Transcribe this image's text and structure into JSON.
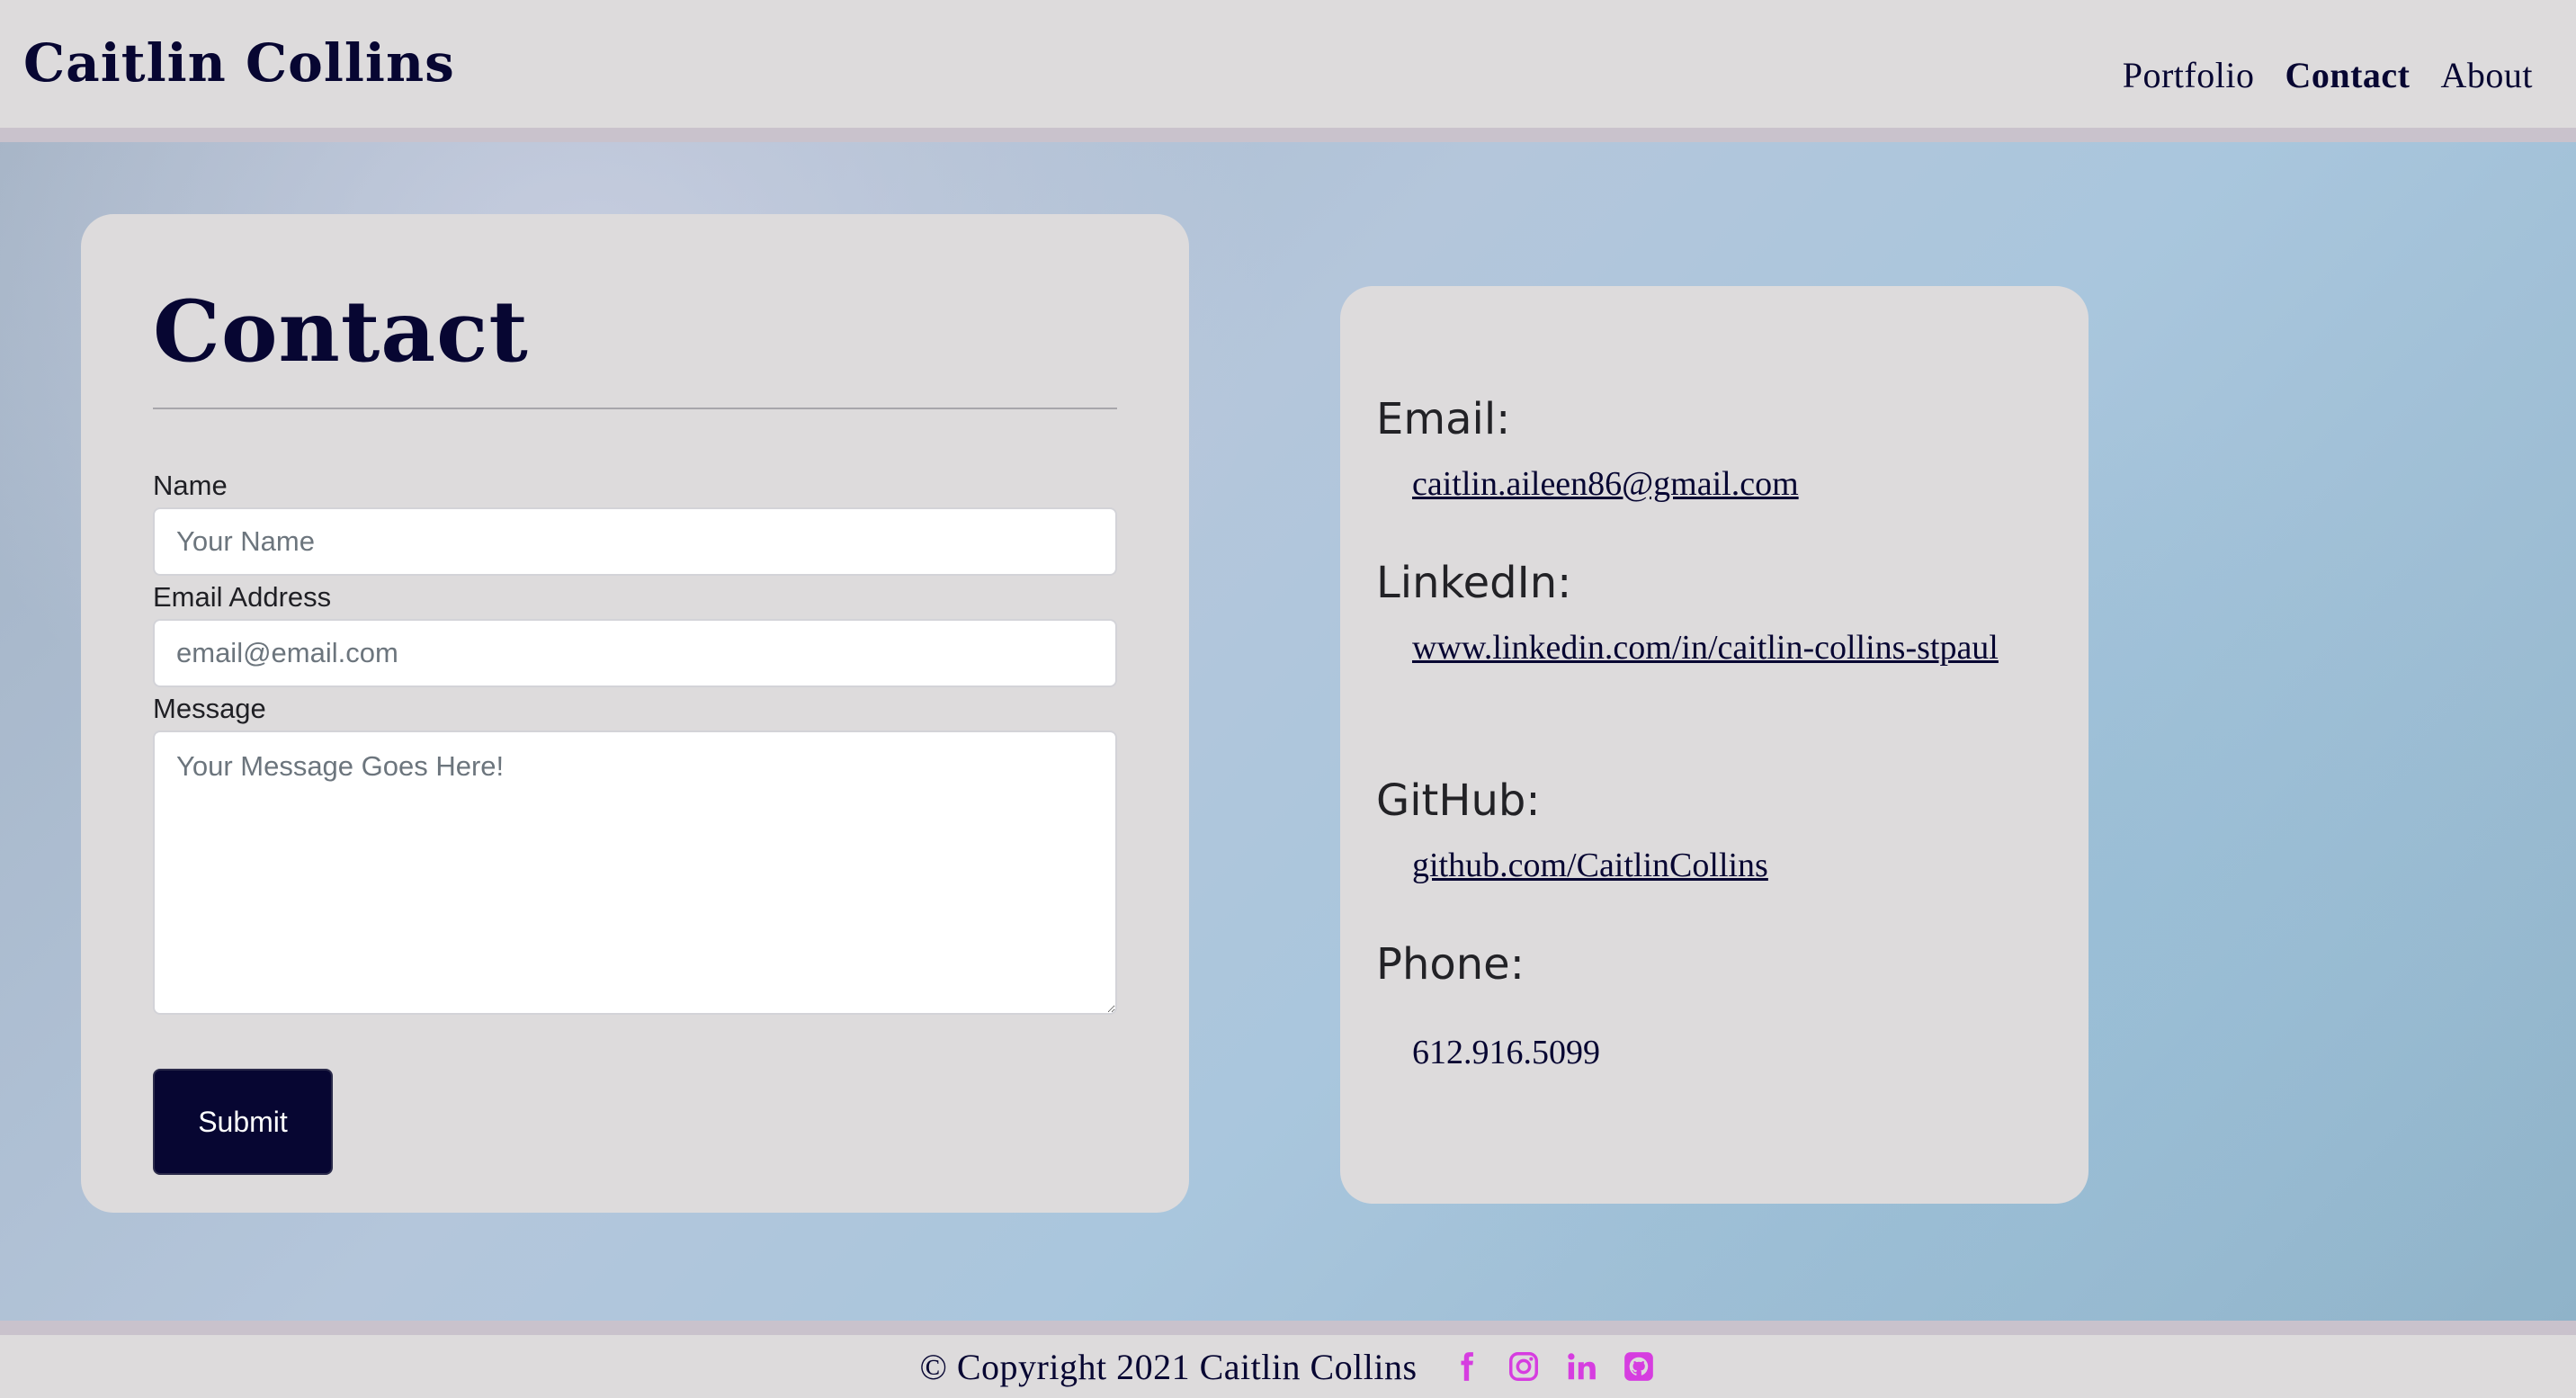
{
  "header": {
    "brand": "Caitlin Collins",
    "nav": [
      {
        "label": "Portfolio",
        "active": false
      },
      {
        "label": "Contact",
        "active": true
      },
      {
        "label": "About",
        "active": false
      }
    ]
  },
  "form": {
    "title": "Contact",
    "name_label": "Name",
    "name_placeholder": "Your Name",
    "email_label": "Email Address",
    "email_placeholder": "email@email.com",
    "message_label": "Message",
    "message_placeholder": "Your Message Goes Here!",
    "submit_label": "Submit"
  },
  "info": {
    "email_heading": "Email:",
    "email_value": "caitlin.aileen86@gmail.com",
    "linkedin_heading": "LinkedIn:",
    "linkedin_value": "www.linkedin.com/in/caitlin-collins-stpaul",
    "github_heading": "GitHub:",
    "github_value": "github.com/CaitlinCollins",
    "phone_heading": "Phone:",
    "phone_value": "612.916.5099"
  },
  "footer": {
    "copyright": "© Copyright 2021 Caitlin Collins",
    "social_icons": [
      "facebook-icon",
      "instagram-icon",
      "linkedin-icon",
      "github-icon"
    ],
    "icon_color": "#d63de0"
  },
  "colors": {
    "navy": "#070632",
    "panel": "#dddbdc",
    "accent": "#d63de0"
  }
}
